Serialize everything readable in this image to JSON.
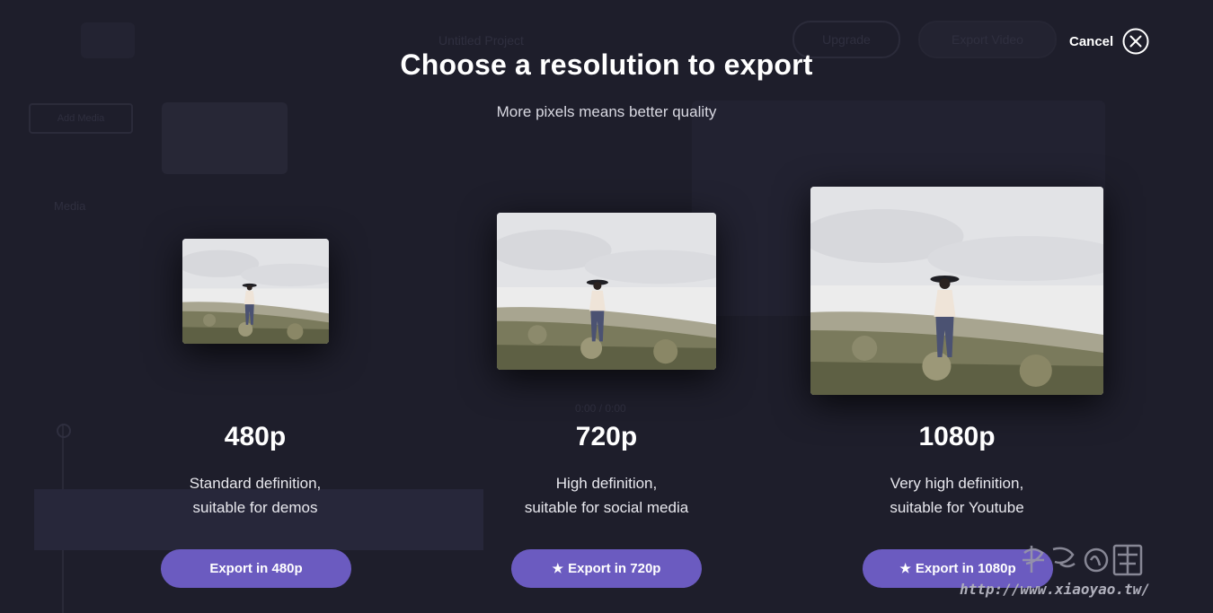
{
  "background_app": {
    "project_title": "Untitled Project",
    "upgrade_label": "Upgrade",
    "export_label": "Export Video",
    "add_media_label": "Add Media",
    "media_label": "Media",
    "timecode": "0:00 / 0:00"
  },
  "modal": {
    "title": "Choose a resolution to export",
    "subtitle": "More pixels means better quality",
    "cancel_label": "Cancel",
    "options": [
      {
        "resolution": "480p",
        "desc_line1": "Standard definition,",
        "desc_line2": "suitable for demos",
        "button_label": "Export in 480p",
        "premium": false
      },
      {
        "resolution": "720p",
        "desc_line1": "High definition,",
        "desc_line2": "suitable for social media",
        "button_label": "Export in 720p",
        "premium": true
      },
      {
        "resolution": "1080p",
        "desc_line1": "Very high definition,",
        "desc_line2": "suitable for Youtube",
        "button_label": "Export in 1080p",
        "premium": true
      }
    ]
  },
  "watermark": {
    "url": "http://www.xiaoyao.tw/"
  },
  "colors": {
    "background": "#1e1e2b",
    "accent_button": "#6b5bc0",
    "text": "#ffffff"
  }
}
